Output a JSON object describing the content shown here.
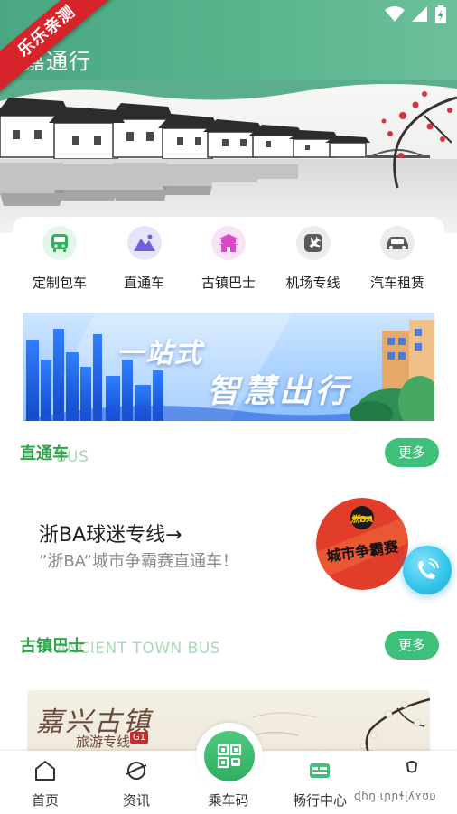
{
  "header": {
    "title": "嘉通行",
    "ribbon": "乐乐亲测",
    "colors": {
      "primary": "#4aa782",
      "accent_green": "#3ec07a"
    },
    "status_icons": [
      "wifi-icon",
      "signal-icon",
      "battery-icon"
    ]
  },
  "services": [
    {
      "label": "定制包车",
      "icon": "bus-icon"
    },
    {
      "label": "直通车",
      "icon": "mountain-icon"
    },
    {
      "label": "古镇巴士",
      "icon": "pagoda-icon"
    },
    {
      "label": "机场专线",
      "icon": "airplane-icon"
    },
    {
      "label": "汽车租赁",
      "icon": "car-icon"
    }
  ],
  "banner": {
    "line1": "一站式",
    "line2": "智慧出行"
  },
  "direct": {
    "title": "直通车",
    "subtitle": "BUS",
    "more": "更多",
    "route_title": "浙BA球迷专线→",
    "route_desc": "”浙BA“城市争霸赛直通车！",
    "route_image_text": "城市争霸赛",
    "route_image_badge": "浙BA"
  },
  "town": {
    "title": "古镇巴士",
    "subtitle": "ANCIENT TOWN BUS",
    "more": "更多",
    "card_calligraphy": "嘉兴古镇",
    "card_sub": "旅游专线",
    "card_badge": "G1"
  },
  "bottom_nav": [
    {
      "label": "首页",
      "icon": "home-icon"
    },
    {
      "label": "资讯",
      "icon": "planet-icon"
    },
    {
      "label": "乘车码",
      "icon": "qr-bus-icon"
    },
    {
      "label": "畅行中心",
      "icon": "ticket-icon"
    },
    {
      "label": "我的",
      "icon": "user-icon"
    }
  ],
  "watermark": "ɖɦŋ ɩɲɲɬɭʎʏʊʋ"
}
